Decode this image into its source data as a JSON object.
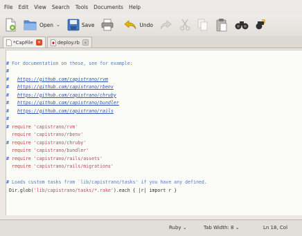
{
  "menubar": {
    "items": [
      "File",
      "Edit",
      "View",
      "Search",
      "Tools",
      "Documents",
      "Help"
    ]
  },
  "toolbar": {
    "open_label": "Open",
    "save_label": "Save",
    "undo_label": "Undo"
  },
  "tabs": [
    {
      "label": "*CapFile",
      "active": true
    },
    {
      "label": "deploy.rb",
      "active": false
    }
  ],
  "editor": {
    "lines": [
      {
        "gutter": "",
        "parts": []
      },
      {
        "gutter": "#",
        "parts": [
          {
            "c": "comment",
            "t": " For documentation on these, see for example:"
          }
        ]
      },
      {
        "gutter": "#",
        "parts": []
      },
      {
        "gutter": "#",
        "parts": [
          {
            "c": "comment",
            "t": "   "
          },
          {
            "c": "link",
            "t": "https://github.com/capistrano/rvm"
          }
        ]
      },
      {
        "gutter": "#",
        "parts": [
          {
            "c": "comment",
            "t": "   "
          },
          {
            "c": "link",
            "t": "https://github.com/capistrano/rbenv"
          }
        ]
      },
      {
        "gutter": "#",
        "parts": [
          {
            "c": "comment",
            "t": "   "
          },
          {
            "c": "link",
            "t": "https://github.com/capistrano/chruby"
          }
        ]
      },
      {
        "gutter": "#",
        "parts": [
          {
            "c": "comment",
            "t": "   "
          },
          {
            "c": "link",
            "t": "https://github.com/capistrano/bundler"
          }
        ]
      },
      {
        "gutter": "#",
        "parts": [
          {
            "c": "comment",
            "t": "   "
          },
          {
            "c": "link",
            "t": "https://github.com/capistrano/rails"
          }
        ]
      },
      {
        "gutter": "#",
        "parts": []
      },
      {
        "gutter": "#",
        "parts": [
          {
            "c": "kw",
            "t": " require"
          },
          {
            "c": "str",
            "t": " 'capistrano/rvm'"
          }
        ]
      },
      {
        "gutter": "",
        "parts": [
          {
            "c": "kw",
            "t": " require"
          },
          {
            "c": "str",
            "t": " 'capistrano/rbenv'"
          }
        ]
      },
      {
        "gutter": "#",
        "parts": [
          {
            "c": "kw",
            "t": " require"
          },
          {
            "c": "str",
            "t": " 'capistrano/chruby'"
          }
        ]
      },
      {
        "gutter": "",
        "parts": [
          {
            "c": "kw",
            "t": " require"
          },
          {
            "c": "str",
            "t": " 'capistrano/bundler'"
          }
        ]
      },
      {
        "gutter": "#",
        "parts": [
          {
            "c": "kw",
            "t": " require"
          },
          {
            "c": "str",
            "t": " 'capistrano/rails/assets'"
          }
        ]
      },
      {
        "gutter": "",
        "parts": [
          {
            "c": "kw",
            "t": " require"
          },
          {
            "c": "str",
            "t": " 'capistrano/rails/migrations'"
          }
        ]
      },
      {
        "gutter": "",
        "parts": []
      },
      {
        "gutter": "#",
        "parts": [
          {
            "c": "comment",
            "t": " Loads custom tasks from `lib/capistrano/tasks' if you have any defined."
          }
        ]
      },
      {
        "gutter": "",
        "parts": [
          {
            "c": "plain",
            "t": "Dir.glob("
          },
          {
            "c": "str",
            "t": "'lib/capistrano/tasks/*.rake'"
          },
          {
            "c": "plain",
            "t": ").each { |r| import r }"
          }
        ]
      }
    ]
  },
  "statusbar": {
    "language": "Ruby",
    "tab_width": "Tab Width: 8",
    "position": "Ln 18, Col"
  },
  "colors": {
    "comment": "#4f7cc5",
    "string": "#c1446b",
    "keyword": "#c43a3a"
  }
}
